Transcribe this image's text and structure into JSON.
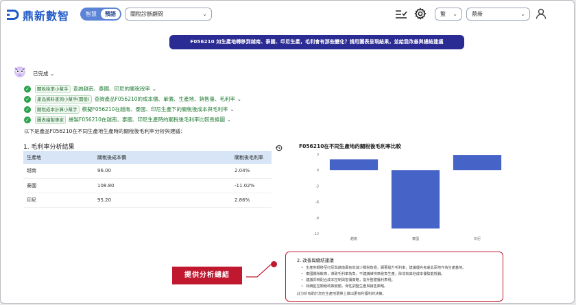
{
  "header": {
    "logo_text": "鼎新數智",
    "modes": [
      "智慧",
      "預語"
    ],
    "active_mode": 1,
    "assistant_select": "關稅診斷顧問",
    "language_select": "繁",
    "user_select": "鼎新"
  },
  "question": "F056210 如生產地轉移到越南、泰國、印尼生產，毛利會有那些變化？請用圖表呈現結果，並給我改善與總結建議",
  "status": "已完成",
  "steps": [
    {
      "agent": "關稅稅率小幫手",
      "desc": "查詢越南、泰國、印尼的關稅稅率"
    },
    {
      "agent": "產品資料查詢小幫手(開般)",
      "desc": "查詢產品F056210的成本價、單價、生產地、銷售量、毛利率"
    },
    {
      "agent": "關稅成本計算小幫手",
      "desc": "模擬F056210在越南、泰國、印尼生產下的關稅後成本與毛利率"
    },
    {
      "agent": "圖表繪製專家",
      "desc": "繪製F056210在越南、泰國、印尼生產時的關稅後毛利率比較長條圖"
    }
  ],
  "intro": "以下是產品F056210在不同生產地生產時的關稅後毛利率分析與建議：",
  "section1_title": "1. 毛利率分析結果",
  "table": {
    "headers": [
      "生產地",
      "關稅後成本價",
      "關稅後毛利率"
    ],
    "rows": [
      [
        "越南",
        "96.00",
        "2.04%"
      ],
      [
        "泰國",
        "108.80",
        "-11.02%"
      ],
      [
        "印尼",
        "95.20",
        "2.86%"
      ]
    ]
  },
  "chart_data": {
    "type": "bar",
    "title": "F056210在不同生產地的關稅後毛利率比較",
    "categories": [
      "越南",
      "泰國",
      "印尼"
    ],
    "values": [
      2.04,
      -11.02,
      2.86
    ],
    "yticks": [
      3,
      0,
      -3,
      -6,
      -9,
      -12
    ],
    "ylim": [
      -12,
      3
    ],
    "xlabel": "",
    "ylabel": "",
    "bar_color": "#4664c8"
  },
  "callout": "提供分析總結",
  "improve": {
    "title": "2. 改善與總結建議",
    "items": [
      "生產地轉移至印尼與越南風有效減少關稅負擔，顯著提升毛利率，建議優先考慮此兩地作為生產基地。",
      "泰國關稅較高，導致毛利率為負，不建議維持高稅負生產，除非有其他成本優勢能抵銷。",
      "建議同時配合成本控制與售價策略，提升整體獲利表現。",
      "持續監控關稅政策變動，保性調整生產與銷售策略。"
    ],
    "summary": "此分析有助於您在生產地選擇上做出更有利獲利的決策。"
  }
}
